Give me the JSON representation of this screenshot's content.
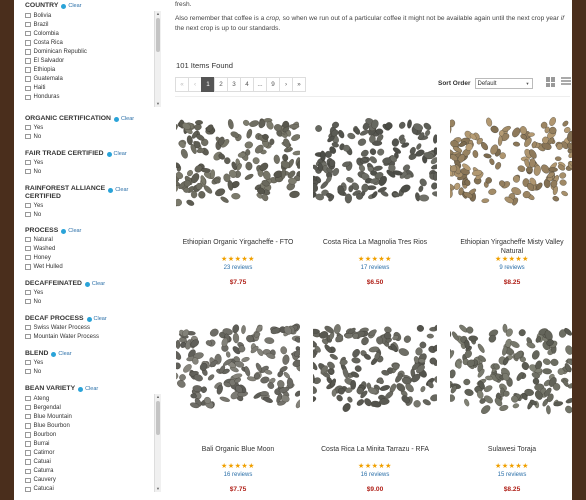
{
  "sidebar": {
    "clear_label": "Clear",
    "country": {
      "title": "COUNTRY",
      "options": [
        "Bolivia",
        "Brazil",
        "Colombia",
        "Costa Rica",
        "Dominican Republic",
        "El Salvador",
        "Ethiopia",
        "Guatemala",
        "Haiti",
        "Honduras"
      ]
    },
    "organic": {
      "title": "ORGANIC CERTIFICATION",
      "options": [
        "Yes",
        "No"
      ]
    },
    "fairtrade": {
      "title": "FAIR TRADE CERTIFIED",
      "options": [
        "Yes",
        "No"
      ]
    },
    "rainforest": {
      "title_line1": "RAINFOREST ALLIANCE",
      "title_line2": "CERTIFIED",
      "options": [
        "Yes",
        "No"
      ]
    },
    "process": {
      "title": "PROCESS",
      "options": [
        "Natural",
        "Washed",
        "Honey",
        "Wet Hulled"
      ]
    },
    "decaf": {
      "title": "DECAFFEINATED",
      "options": [
        "Yes",
        "No"
      ]
    },
    "decafprocess": {
      "title": "DECAF PROCESS",
      "options": [
        "Swiss Water Process",
        "Mountain Water Process"
      ]
    },
    "blend": {
      "title": "BLEND",
      "options": [
        "Yes",
        "No"
      ]
    },
    "variety": {
      "title": "BEAN VARIETY",
      "options": [
        "Ateng",
        "Bergendal",
        "Blue Mountain",
        "Blue Bourbon",
        "Bourbon",
        "Burrai",
        "Catimor",
        "Catuai",
        "Caturra",
        "Cauvery",
        "Catucai"
      ]
    }
  },
  "intro": {
    "line0": "fresh.",
    "p2_a": "Also remember that coffee is a ",
    "p2_em": "crop,",
    "p2_b": " so when we run out of a particular coffee it might not be available again until the next crop year ",
    "p2_em2": "if",
    "p2_c": " the next crop is up to our standards."
  },
  "results": {
    "count_text": "101 Items Found",
    "pager": [
      "«",
      "‹",
      "1",
      "2",
      "3",
      "4",
      "...",
      "9",
      "›",
      "»"
    ],
    "sort_label": "Sort Order",
    "sort_value": "Default"
  },
  "products": [
    {
      "name": "Ethiopian Organic Yirgacheffe - FTO",
      "stars": "★★★★★",
      "reviews": "23 reviews",
      "price": "$7.75",
      "rating": 5,
      "bean": "#6b6a5e"
    },
    {
      "name": "Costa Rica La Magnolia Tres Rios",
      "stars": "★★★★★",
      "reviews": "17 reviews",
      "price": "$6.50",
      "rating": 5,
      "bean": "#5e5f58"
    },
    {
      "name": "Ethiopian Yirgacheffe Misty Valley Natural",
      "stars": "★★★★★",
      "reviews": "9 reviews",
      "price": "$8.25",
      "rating": 5,
      "bean": "#9a8462"
    },
    {
      "name": "Bali Organic Blue Moon",
      "stars": "★★★★★",
      "reviews": "16 reviews",
      "price": "$7.75",
      "rating": 5,
      "bean": "#72716a"
    },
    {
      "name": "Costa Rica La Minita Tarrazu - RFA",
      "stars": "★★★★★",
      "reviews": "16 reviews",
      "price": "$9.00",
      "rating": 5,
      "bean": "#66665e"
    },
    {
      "name": "Sulawesi Toraja",
      "stars": "★★★★★",
      "reviews": "15 reviews",
      "price": "$8.25",
      "rating": 5,
      "bean": "#6d6e63"
    }
  ]
}
